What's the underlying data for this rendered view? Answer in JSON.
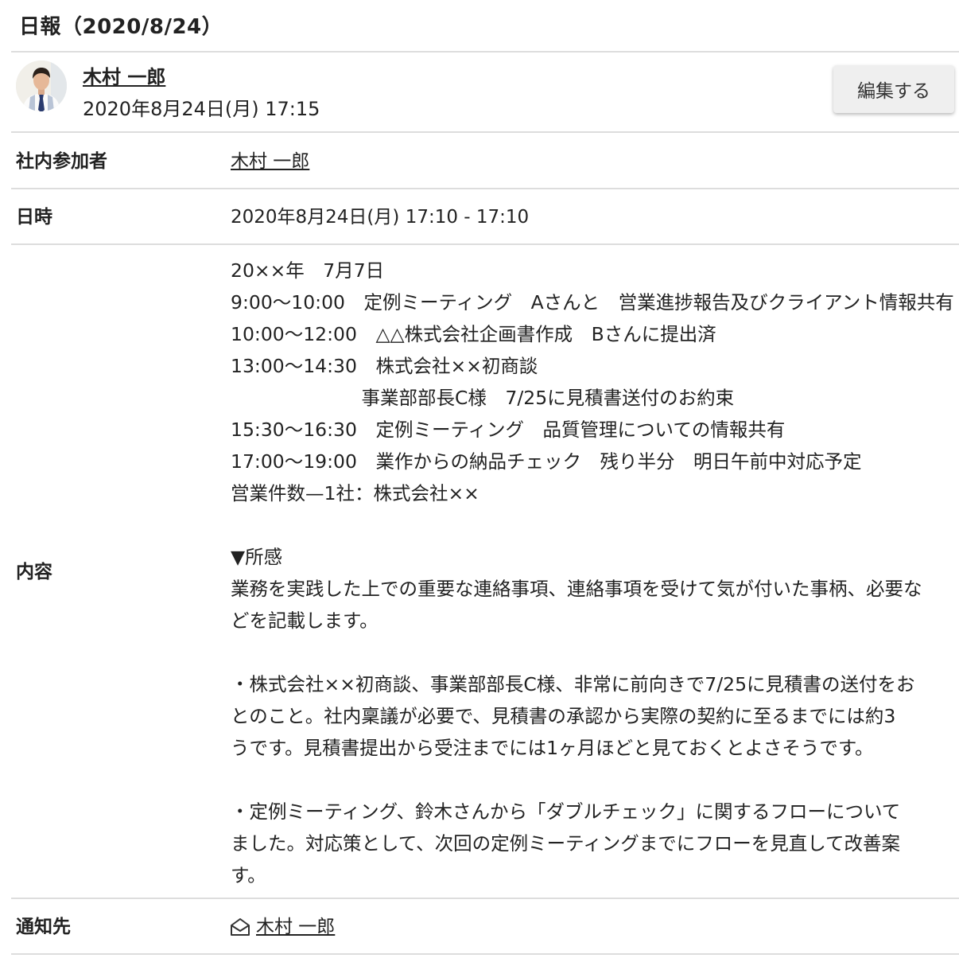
{
  "report": {
    "title": "日報（2020/8/24）",
    "author_name": "木村 一郎",
    "posted_at": "2020年8月24日(月) 17:15",
    "edit_label": "編集する"
  },
  "fields": {
    "participants_label": "社内参加者",
    "participants_value": "木村 一郎",
    "datetime_label": "日時",
    "datetime_value": "2020年8月24日(月) 17:10 - 17:10",
    "content_label": "内容",
    "content_text": "20××年　7月7日\n9:00〜10:00　定例ミーティング　Aさんと　営業進捗報告及びクライアント情報共有\n10:00〜12:00　△△株式会社企画書作成　Bさんに提出済\n13:00〜14:30　株式会社××初商談\n　　　　　　　事業部部長C様　7/25に見積書送付のお約束\n15:30〜16:30　定例ミーティング　品質管理についての情報共有\n17:00〜19:00　業作からの納品チェック　残り半分　明日午前中対応予定\n営業件数—1社：株式会社××\n\n▼所感\n業務を実践した上での重要な連絡事項、連絡事項を受けて気が付いた事柄、必要な\nどを記載します。\n\n・株式会社××初商談、事業部部長C様、非常に前向きで7/25に見積書の送付をお\nとのこと。社内稟議が必要で、見積書の承認から実際の契約に至るまでには約3\nうです。見積書提出から受注までには1ヶ月ほどと見ておくとよさそうです。\n\n・定例ミーティング、鈴木さんから「ダブルチェック」に関するフローについて\nました。対応策として、次回の定例ミーティングまでにフローを見直して改善案\nす。",
    "notify_label": "通知先",
    "notify_value": "木村 一郎",
    "notify_icon": "mail-open-icon"
  }
}
